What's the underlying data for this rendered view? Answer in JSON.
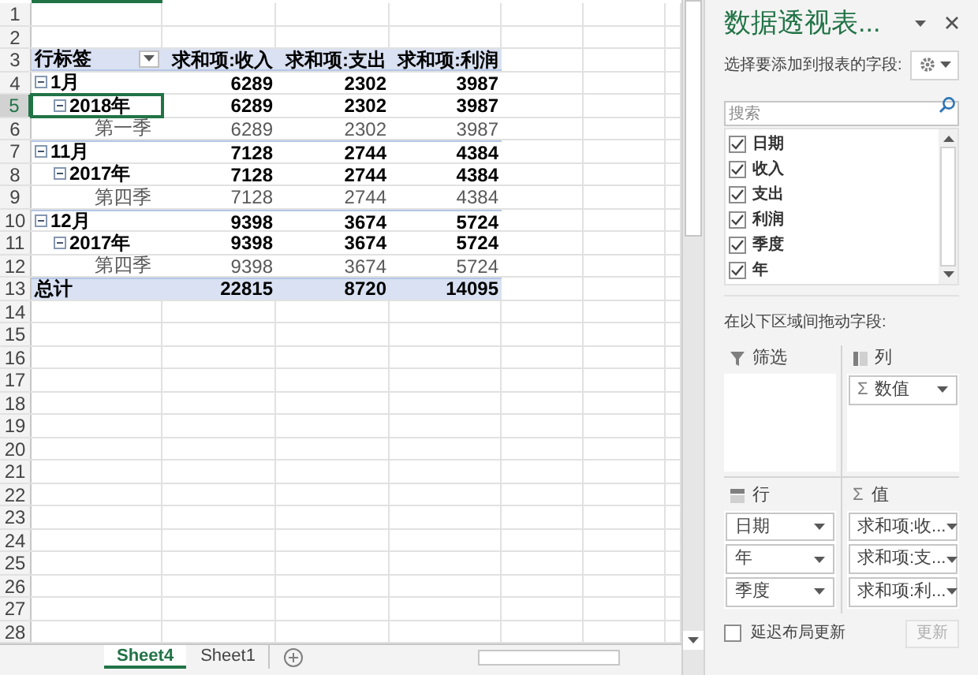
{
  "sheet": {
    "row_headers": [
      {
        "label": "1",
        "selected": false
      },
      {
        "label": "2",
        "selected": false
      },
      {
        "label": "3",
        "selected": false
      },
      {
        "label": "4",
        "selected": false
      },
      {
        "label": "5",
        "selected": true
      },
      {
        "label": "6",
        "selected": false
      },
      {
        "label": "7",
        "selected": false
      },
      {
        "label": "8",
        "selected": false
      },
      {
        "label": "9",
        "selected": false
      },
      {
        "label": "10",
        "selected": false
      },
      {
        "label": "11",
        "selected": false
      },
      {
        "label": "12",
        "selected": false
      },
      {
        "label": "13",
        "selected": false
      },
      {
        "label": "14",
        "selected": false
      },
      {
        "label": "15",
        "selected": false
      },
      {
        "label": "16",
        "selected": false
      },
      {
        "label": "17",
        "selected": false
      },
      {
        "label": "18",
        "selected": false
      },
      {
        "label": "19",
        "selected": false
      },
      {
        "label": "20",
        "selected": false
      },
      {
        "label": "21",
        "selected": false
      },
      {
        "label": "22",
        "selected": false
      },
      {
        "label": "23",
        "selected": false
      },
      {
        "label": "24",
        "selected": false
      },
      {
        "label": "25",
        "selected": false
      },
      {
        "label": "26",
        "selected": false
      },
      {
        "label": "27",
        "selected": false
      },
      {
        "label": "28",
        "selected": false
      }
    ],
    "pivot": {
      "header": [
        "行标签",
        "求和项:收入",
        "求和项:支出",
        "求和项:利润"
      ],
      "rows": [
        {
          "label": "1月",
          "values": [
            "6289",
            "2302",
            "3987"
          ],
          "expanded": true,
          "selected": false,
          "children": [
            {
              "label": "2018年",
              "values": [
                "6289",
                "2302",
                "3987"
              ],
              "expanded": true,
              "selected": true,
              "children": [
                {
                  "label": "第一季",
                  "values": [
                    "6289",
                    "2302",
                    "3987"
                  ],
                  "selected": false
                }
              ]
            }
          ]
        },
        {
          "label": "11月",
          "values": [
            "7128",
            "2744",
            "4384"
          ],
          "expanded": true,
          "selected": false,
          "children": [
            {
              "label": "2017年",
              "values": [
                "7128",
                "2744",
                "4384"
              ],
              "expanded": true,
              "selected": false,
              "children": [
                {
                  "label": "第四季",
                  "values": [
                    "7128",
                    "2744",
                    "4384"
                  ],
                  "selected": false
                }
              ]
            }
          ]
        },
        {
          "label": "12月",
          "values": [
            "9398",
            "3674",
            "5724"
          ],
          "expanded": true,
          "selected": false,
          "children": [
            {
              "label": "2017年",
              "values": [
                "9398",
                "3674",
                "5724"
              ],
              "expanded": true,
              "selected": false,
              "children": [
                {
                  "label": "第四季",
                  "values": [
                    "9398",
                    "3674",
                    "5724"
                  ],
                  "selected": false
                }
              ]
            }
          ]
        }
      ],
      "total": {
        "label": "总计",
        "values": [
          "22815",
          "8720",
          "14095"
        ]
      }
    },
    "tabs": [
      {
        "label": "Sheet4",
        "selected": true
      },
      {
        "label": "Sheet1",
        "selected": false
      }
    ]
  },
  "panel": {
    "title": "数据透视表...",
    "choose_label": "选择要添加到报表的字段:",
    "search": {
      "placeholder": "搜索"
    },
    "fields": [
      {
        "label": "日期",
        "checked": true
      },
      {
        "label": "收入",
        "checked": true
      },
      {
        "label": "支出",
        "checked": true
      },
      {
        "label": "利润",
        "checked": true
      },
      {
        "label": "季度",
        "checked": true
      },
      {
        "label": "年",
        "checked": true
      }
    ],
    "drag_label": "在以下区域间拖动字段:",
    "areas": [
      {
        "kind": "filter",
        "label": "筛选"
      },
      {
        "kind": "columns",
        "label": "列",
        "items": [
          {
            "prefix": "Σ",
            "label": "数值"
          }
        ]
      },
      {
        "kind": "rows",
        "label": "行",
        "items": [
          {
            "label": "日期"
          },
          {
            "label": "年"
          },
          {
            "label": "季度"
          }
        ]
      },
      {
        "kind": "values",
        "label": "值",
        "icon_text": "Σ",
        "items": [
          {
            "label": "求和项:收..."
          },
          {
            "label": "求和项:支..."
          },
          {
            "label": "求和项:利..."
          }
        ]
      }
    ],
    "defer": {
      "label": "延迟布局更新",
      "checked": false
    },
    "update_button": {
      "label": "更新",
      "disabled": true
    }
  }
}
